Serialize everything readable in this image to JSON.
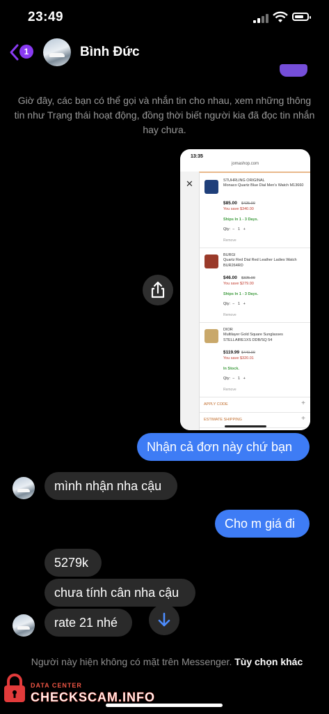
{
  "status": {
    "time": "23:49"
  },
  "header": {
    "back_badge": "1",
    "name": "Bình Đức"
  },
  "system_note": "Giờ đây, các bạn có thể gọi và nhắn tin cho nhau, xem những thông tin như Trạng thái hoạt động, đồng thời biết người kia đã đọc tin nhắn hay chưa.",
  "screenshot": {
    "time": "13:35",
    "url": "jomashop.com",
    "products": [
      {
        "brand": "STUHRLING ORIGINAL",
        "name": "Monaco Quartz Blue Dial Men's Watch M13660",
        "price": "$85.00",
        "old_price": "$425.00",
        "save": "You save $340.00",
        "ship": "Ships In 1 - 3 Days.",
        "qty_label": "Qty:",
        "qty": "1",
        "remove": "Remove",
        "img_color": "#1f3f7a"
      },
      {
        "brand": "BURGI",
        "name": "Quartz Red Dial Red Leather Ladies Watch BUR264RD",
        "price": "$46.00",
        "old_price": "$325.00",
        "save": "You save $279.00",
        "ship": "Ships In 1 - 3 Days.",
        "qty_label": "Qty:",
        "qty": "1",
        "remove": "Remove",
        "img_color": "#9a3a2a"
      },
      {
        "brand": "DIOR",
        "name": "Multilayer Gold Square Sunglasses STELLAIRE1XS DDB/SQ 54",
        "price": "$119.99",
        "old_price": "$440.00",
        "save": "You save $320.01",
        "ship": "In Stock.",
        "qty_label": "Qty:",
        "qty": "1",
        "remove": "Remove",
        "img_color": "#c9a86a"
      }
    ],
    "apply_code": "APPLY CODE",
    "estimate_shipping": "ESTIMATE SHIPPING"
  },
  "messages": [
    {
      "from": "me",
      "text": "Nhận cả đơn này chứ bạn"
    },
    {
      "from": "them",
      "text": "mình nhận nha cậu"
    },
    {
      "from": "me",
      "text": "Cho m giá đi"
    },
    {
      "from": "them",
      "text": "5279k"
    },
    {
      "from": "them",
      "text": "chưa tính cân nha cậu"
    },
    {
      "from": "them",
      "text": "rate 21 nhé"
    }
  ],
  "footer": {
    "note": "Người này hiện không có mặt trên Messenger.",
    "link": "Tùy chọn khác"
  },
  "watermark": {
    "label": "DATA CENTER",
    "brand": "CHECKSCAM.INFO"
  },
  "colors": {
    "accent": "#8a3bf3",
    "outgoing_bubble": "#3e7cf5",
    "incoming_bubble": "#2a2a2a"
  }
}
